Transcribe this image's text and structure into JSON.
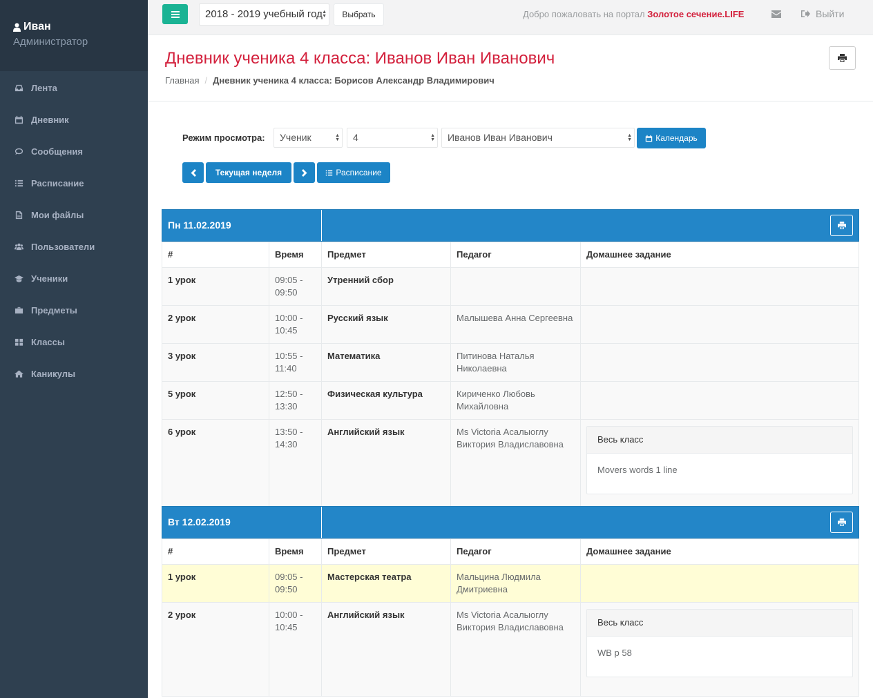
{
  "sidebar": {
    "user_name": "Иван",
    "user_role": "Администратор",
    "items": [
      {
        "label": "Лента",
        "icon": "inbox-icon"
      },
      {
        "label": "Дневник",
        "icon": "calendar-icon"
      },
      {
        "label": "Сообщения",
        "icon": "comment-icon"
      },
      {
        "label": "Расписание",
        "icon": "list-icon"
      },
      {
        "label": "Мои файлы",
        "icon": "file-icon"
      },
      {
        "label": "Пользователи",
        "icon": "users-icon"
      },
      {
        "label": "Ученики",
        "icon": "graduation-cap-icon"
      },
      {
        "label": "Предметы",
        "icon": "briefcase-icon"
      },
      {
        "label": "Классы",
        "icon": "grid-icon"
      },
      {
        "label": "Каникулы",
        "icon": "home-icon"
      }
    ]
  },
  "topbar": {
    "year_value": "2018 - 2019 учебный год",
    "choose_label": "Выбрать",
    "welcome_text": "Добро пожаловать на портал",
    "brand": "Золотое сечение.LIFE",
    "logout_label": "Выйти"
  },
  "heading": {
    "title": "Дневник ученика 4 класса: Иванов Иван Иванович",
    "breadcrumb_home": "Главная",
    "breadcrumb_current": "Дневник ученика 4 класса: Борисов Александр Владимирович"
  },
  "filters": {
    "mode_label": "Режим просмотра:",
    "mode_value": "Ученик",
    "class_value": "4",
    "student_value": "Иванов Иван Иванович",
    "calendar_label": "Календарь",
    "current_week_label": "Текущая неделя",
    "schedule_label": "Расписание"
  },
  "columns": [
    "#",
    "Время",
    "Предмет",
    "Педагог",
    "Домашнее задание"
  ],
  "days": [
    {
      "date": "Пн 11.02.2019",
      "rows": [
        {
          "lesson": "1 урок",
          "time": "09:05 - 09:50",
          "subject": "Утренний сбор",
          "teacher": "",
          "hw_group": "",
          "hw_text": ""
        },
        {
          "lesson": "2 урок",
          "time": "10:00 - 10:45",
          "subject": "Русский язык",
          "teacher": "Малышева Анна Сергеевна",
          "hw_group": "",
          "hw_text": ""
        },
        {
          "lesson": "3 урок",
          "time": "10:55 - 11:40",
          "subject": "Математика",
          "teacher": "Питинова Наталья Николаевна",
          "hw_group": "",
          "hw_text": ""
        },
        {
          "lesson": "5 урок",
          "time": "12:50 - 13:30",
          "subject": "Физическая культура",
          "teacher": "Кириченко Любовь Михайловна",
          "hw_group": "",
          "hw_text": ""
        },
        {
          "lesson": "6 урок",
          "time": "13:50 - 14:30",
          "subject": "Английский язык",
          "teacher": "Ms Victoria Асалыоглу Виктория Владиславовна",
          "hw_group": "Весь класс",
          "hw_text": "Movers words 1 line"
        }
      ]
    },
    {
      "date": "Вт 12.02.2019",
      "rows": [
        {
          "lesson": "1 урок",
          "time": "09:05 - 09:50",
          "subject": "Мастерская театра",
          "teacher": "Мальцина Людмила Дмитриевна",
          "hw_group": "",
          "hw_text": "",
          "highlight": true
        },
        {
          "lesson": "2 урок",
          "time": "10:00 - 10:45",
          "subject": "Английский язык",
          "teacher": "Ms Victoria Асалыоглу Виктория Владиславовна",
          "hw_group": "Весь класс",
          "hw_text": "WB p 58"
        }
      ]
    }
  ],
  "colors": {
    "accent": "#1ab394",
    "primary": "#1c84c6",
    "brand": "#d3203c",
    "sidebar": "#2f4050"
  }
}
